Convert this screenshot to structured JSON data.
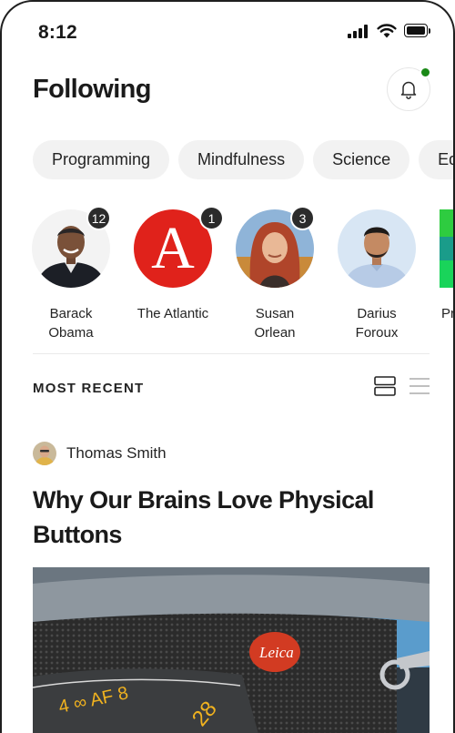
{
  "status_bar": {
    "time": "8:12"
  },
  "header": {
    "title": "Following"
  },
  "topics": [
    "Programming",
    "Mindfulness",
    "Science",
    "Eq"
  ],
  "following": [
    {
      "name_line1": "Barack",
      "name_line2": "Obama",
      "badge": "12"
    },
    {
      "name_line1": "The Atlantic",
      "name_line2": "",
      "badge": "1",
      "logo_letter": "A"
    },
    {
      "name_line1": "Susan",
      "name_line2": "Orlean",
      "badge": "3"
    },
    {
      "name_line1": "Darius",
      "name_line2": "Foroux",
      "badge": ""
    },
    {
      "name_line1": "Pr",
      "name_line2": "",
      "badge": ""
    }
  ],
  "section": {
    "label": "MOST RECENT"
  },
  "article": {
    "author": "Thomas Smith",
    "title": "Why Our Brains Love Physical Buttons"
  },
  "colors": {
    "accent_green": "#1a8917",
    "atlantic_red": "#e0221b",
    "badge_dark": "#2b2b2b"
  },
  "icons": [
    "signal-icon",
    "wifi-icon",
    "battery-icon",
    "bell-icon",
    "card-view-icon",
    "list-view-icon"
  ]
}
